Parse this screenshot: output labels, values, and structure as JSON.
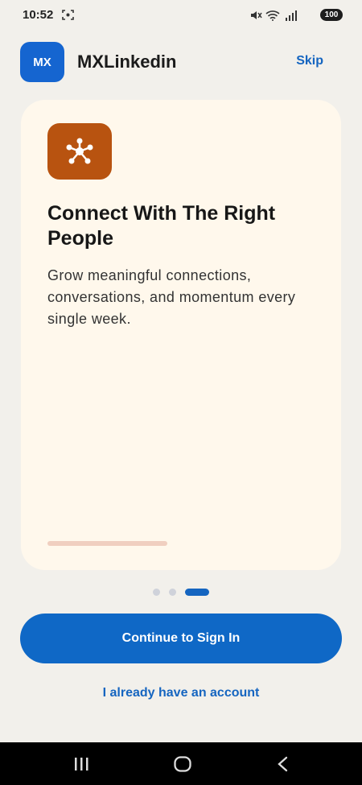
{
  "status_bar": {
    "time": "10:52",
    "battery": "100",
    "icons": [
      "screenshot-icon",
      "mute-icon",
      "wifi-icon",
      "signal-icon",
      "battery-icon"
    ]
  },
  "header": {
    "logo_text": "MX",
    "title": "MXLinkedin",
    "skip_label": "Skip"
  },
  "card": {
    "icon": "network-icon",
    "title": "Connect With The Right People",
    "description": "Grow meaningful connections, conversations, and momentum every single week.",
    "progress": 0.33
  },
  "pagination": {
    "total": 3,
    "active_index": 2
  },
  "actions": {
    "continue_label": "Continue to Sign In",
    "account_label": "I already have an account"
  },
  "nav_bar": {
    "icons": [
      "recent-apps-icon",
      "home-icon",
      "back-icon"
    ]
  },
  "colors": {
    "primary": "#1565c0",
    "logo_bg": "#1565d0",
    "card_bg": "#fff8ec",
    "card_icon_bg": "#b85310",
    "page_bg": "#f2f0eb"
  }
}
